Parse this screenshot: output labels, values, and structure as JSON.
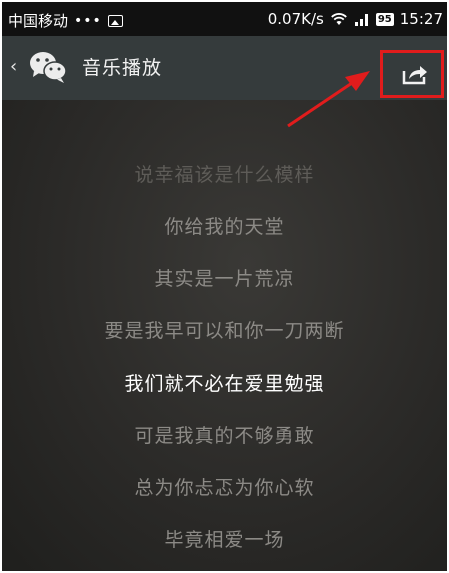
{
  "status_bar": {
    "carrier": "中国移动",
    "dots": "•••",
    "speed": "0.07K/s",
    "battery": "95",
    "time": "15:27"
  },
  "title_bar": {
    "title": "音乐播放",
    "back_icon": "chevron-left-icon",
    "app_icon": "wechat-icon",
    "share_icon": "share-icon",
    "highlight_color": "#e11c1c"
  },
  "lyrics": [
    {
      "text": "说幸福该是什么模样",
      "state": "dim"
    },
    {
      "text": "你给我的天堂",
      "state": "normal"
    },
    {
      "text": "其实是一片荒凉",
      "state": "normal"
    },
    {
      "text": "要是我早可以和你一刀两断",
      "state": "normal"
    },
    {
      "text": "我们就不必在爱里勉强",
      "state": "current"
    },
    {
      "text": "可是我真的不够勇敢",
      "state": "normal"
    },
    {
      "text": "总为你忐忑为你心软",
      "state": "normal"
    },
    {
      "text": "毕竟相爱一场",
      "state": "normal"
    }
  ],
  "annotation": {
    "arrow_color": "#e11c1c"
  }
}
